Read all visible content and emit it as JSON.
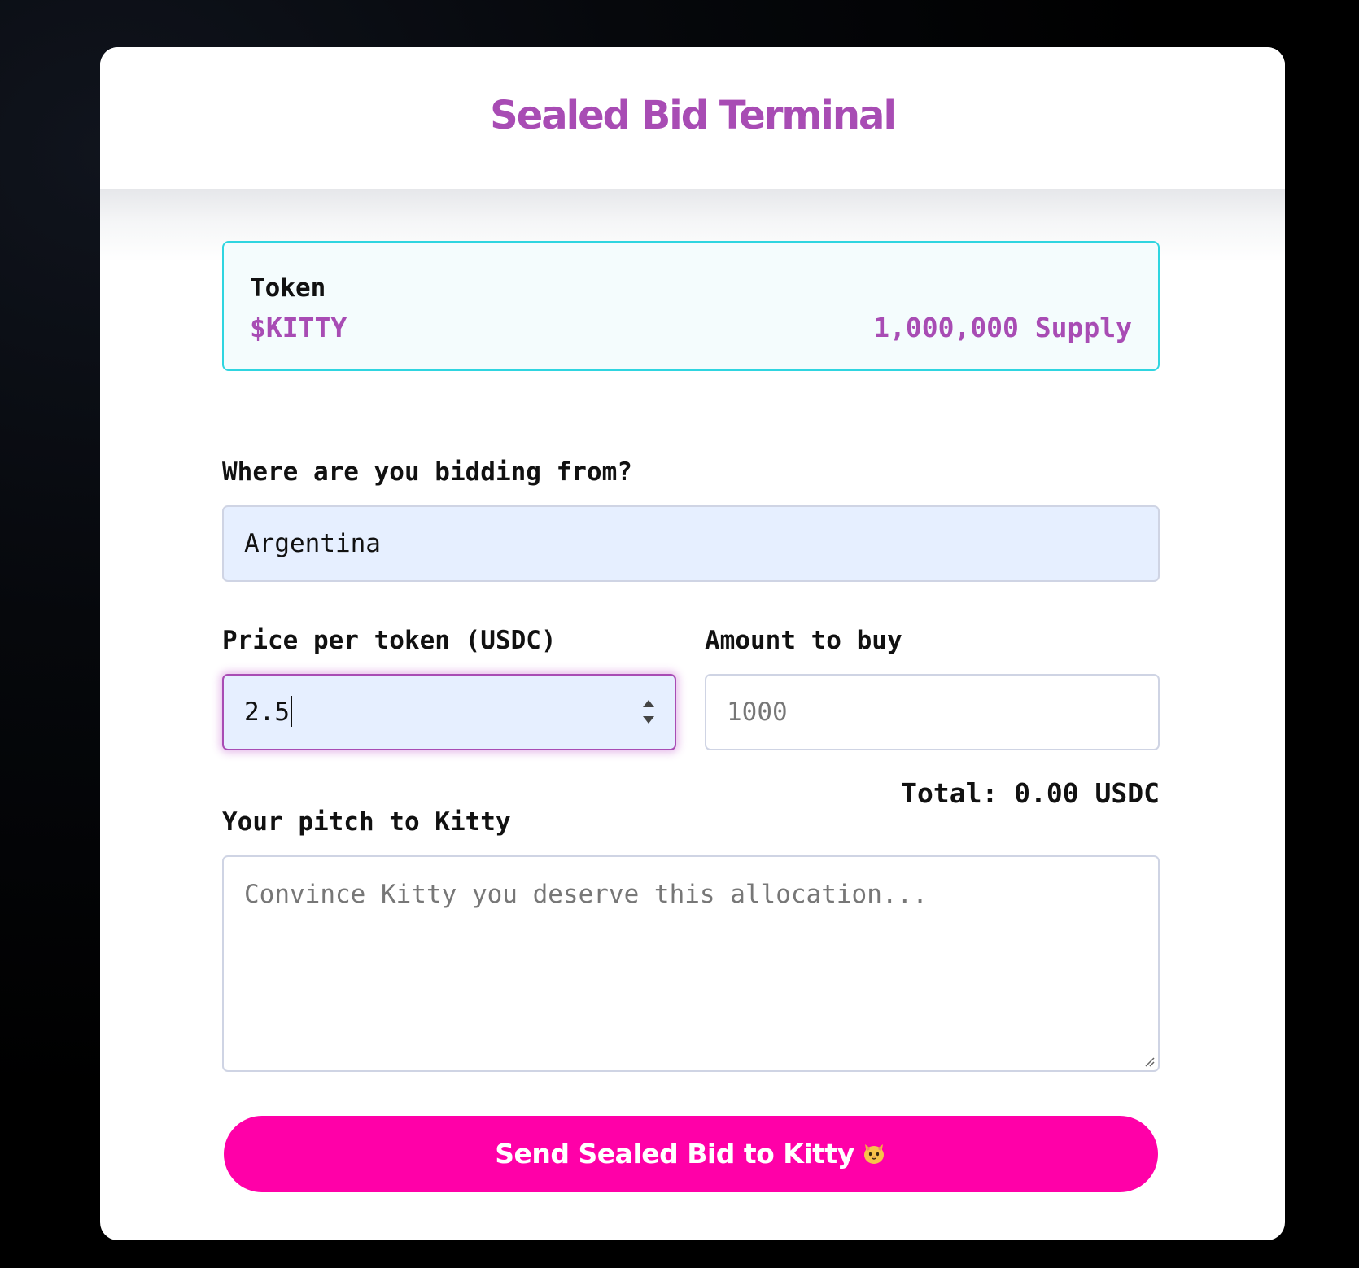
{
  "header": {
    "title": "Sealed Bid Terminal"
  },
  "token": {
    "label": "Token",
    "name": "$KITTY",
    "supply": "1,000,000 Supply"
  },
  "location": {
    "label": "Where are you bidding from?",
    "value": "Argentina"
  },
  "price": {
    "label": "Price per token (USDC)",
    "value": "2.5"
  },
  "amount": {
    "label": "Amount to buy",
    "value": "",
    "placeholder": "1000"
  },
  "total": {
    "text": "Total: 0.00 USDC"
  },
  "pitch": {
    "label": "Your pitch to Kitty",
    "value": "",
    "placeholder": "Convince Kitty you deserve this allocation..."
  },
  "submit": {
    "label": "Send Sealed Bid to Kitty",
    "icon": "cat-face-icon"
  },
  "colors": {
    "accent": "#a84cb4",
    "token_border": "#2fd5e0",
    "button": "#ff00a8",
    "filled_input": "#e6efff"
  }
}
